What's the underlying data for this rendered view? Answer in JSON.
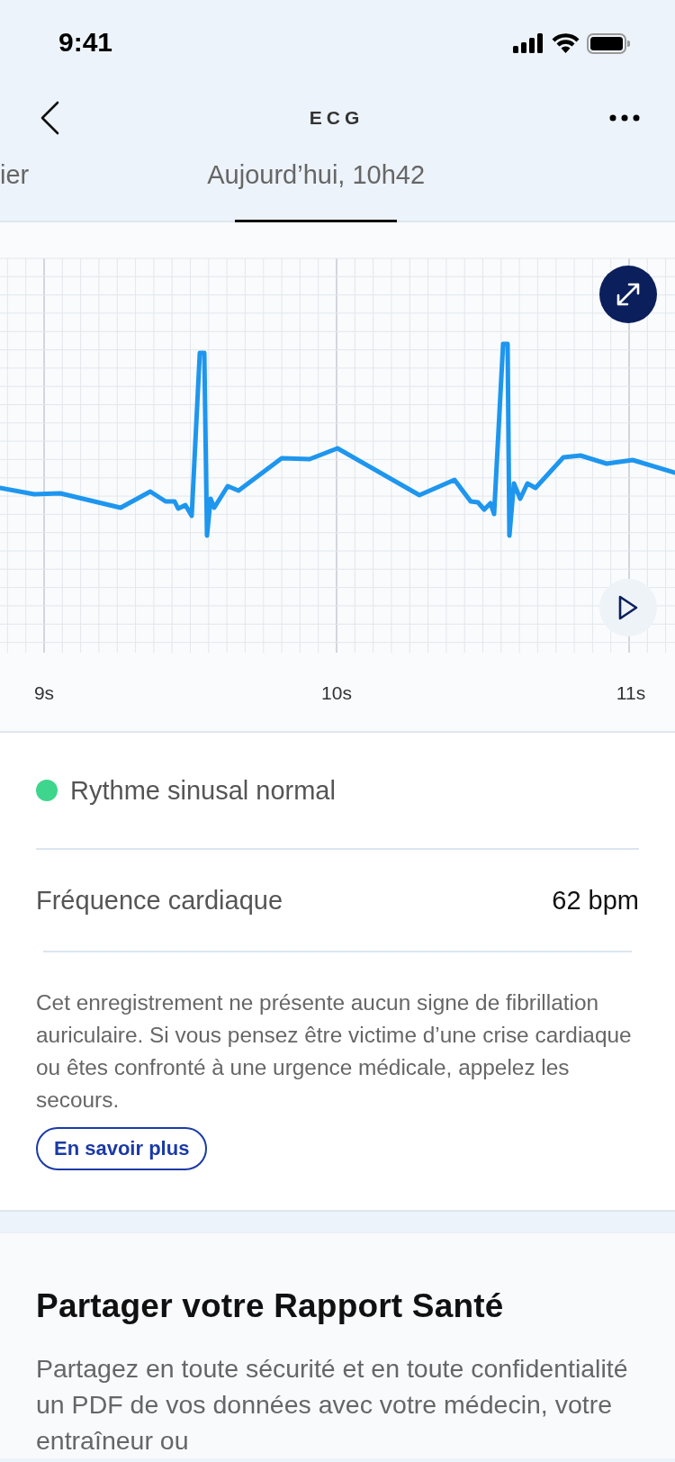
{
  "status_bar": {
    "time": "9:41"
  },
  "header": {
    "title": "ECG"
  },
  "tabs": [
    {
      "label": "ier",
      "selected": false
    },
    {
      "label": "Aujourd’hui, 10h42",
      "selected": true
    }
  ],
  "chart": {
    "x_labels": [
      "9s",
      "10s",
      "11s"
    ]
  },
  "result": {
    "rhythm": {
      "label": "Rythme sinusal normal",
      "color": "#3dd68c"
    },
    "heart_rate": {
      "label": "Fréquence cardiaque",
      "value": "62 bpm"
    },
    "description": "Cet enregistrement ne présente aucun signe de fibrillation auriculaire. Si vous pensez être victime d’une crise cardiaque ou êtes confronté à une urgence médicale, appelez les secours.",
    "button": "En savoir plus"
  },
  "share": {
    "title": "Partager votre Rapport Santé",
    "text": "Partagez en toute sécurité et en toute confidentialité un PDF de vos données avec votre médecin, votre entraîneur ou"
  }
}
